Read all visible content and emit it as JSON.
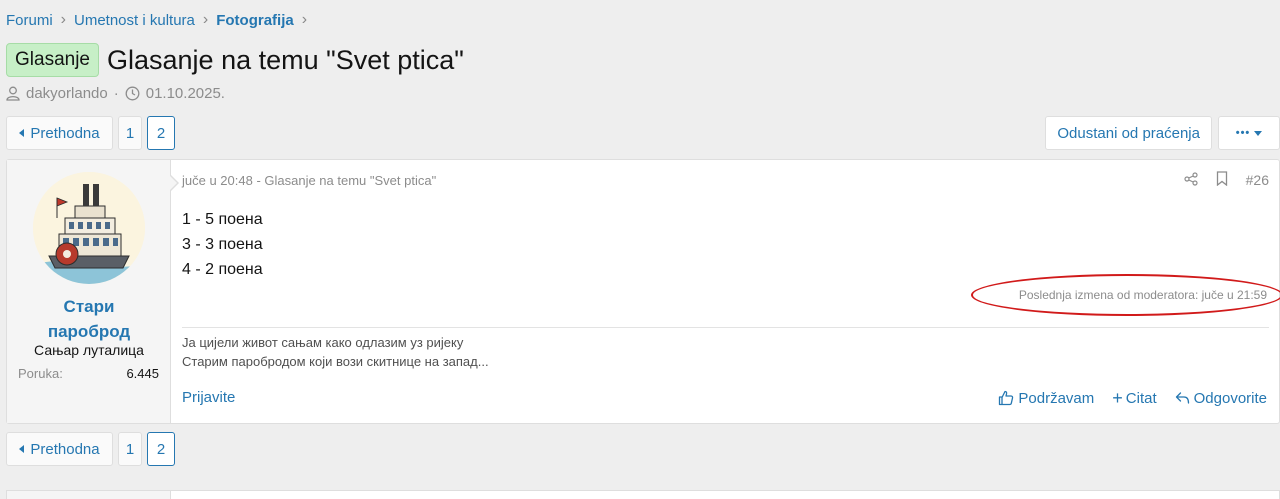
{
  "breadcrumb": [
    {
      "label": "Forumi"
    },
    {
      "label": "Umetnost i kultura"
    },
    {
      "label": "Fotografija"
    }
  ],
  "thread": {
    "prefix": "Glasanje",
    "title": "Glasanje na temu \"Svet ptica\"",
    "author": "dakyorlando",
    "date": "01.10.2025."
  },
  "pagination": {
    "prev_label": "Prethodna",
    "pages": [
      "1",
      "2"
    ],
    "current_page": "2"
  },
  "actions": {
    "unfollow_label": "Odustani od praćenja",
    "more_label": "•••"
  },
  "post": {
    "user": {
      "name_line1": "Стари",
      "name_line2": "пароброд",
      "title": "Сањар луталица",
      "messages_label": "Poruka:",
      "messages_count": "6.445"
    },
    "header": "juče u 20:48 - Glasanje na temu \"Svet ptica\"",
    "number": "#26",
    "body": [
      "1 - 5 поена",
      "3 - 3 поена",
      "4 - 2 поена"
    ],
    "last_edit": "Poslednja izmena od moderatora: juče u 21:59",
    "signature": [
      "Ја цијели живот сањам како одлазим уз ријеку",
      "Старим паробродом који вози скитнице на запад..."
    ],
    "footer": {
      "report": "Prijavite",
      "like": "Podržavam",
      "quote": "Citat",
      "reply": "Odgovorite"
    }
  },
  "colors": {
    "link": "#2577b1",
    "prefix_bg": "#c7efc7",
    "annotation": "#d11a1a"
  }
}
